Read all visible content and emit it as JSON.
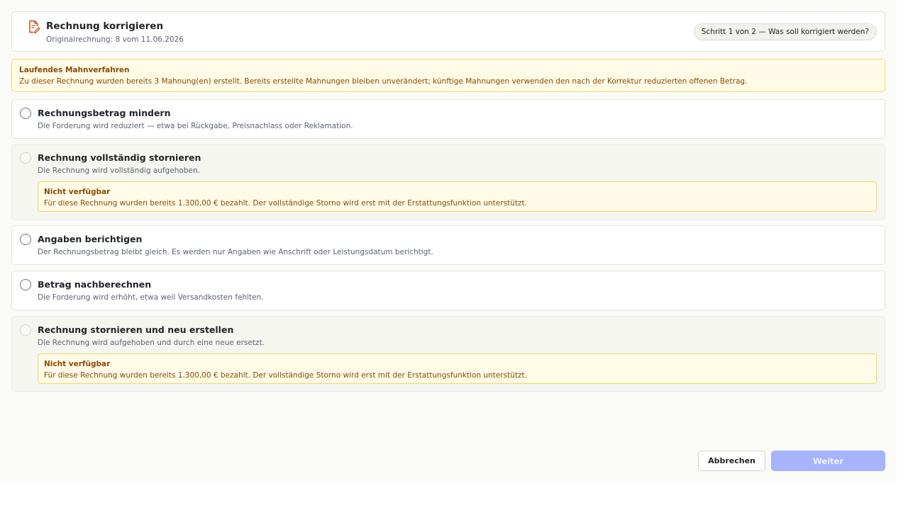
{
  "header": {
    "title": "Rechnung korrigieren",
    "subtitle": "Originalrechnung: 8 vom 11.06.2026",
    "step": "Schritt 1 von 2 — Was soll korrigiert werden?",
    "icon": "document-edit-icon",
    "accent_color": "#c2410c"
  },
  "warning": {
    "title": "Laufendes Mahnverfahren",
    "text": "Zu dieser Rechnung wurden bereits 3 Mahnung(en) erstellt. Bereits erstellte Mahnungen bleiben unverändert; künftige Mahnungen verwenden den nach der Korrektur reduzierten offenen Betrag."
  },
  "options": [
    {
      "title": "Rechnungsbetrag mindern",
      "desc": "Die Forderung wird reduziert — etwa bei Rückgabe, Preisnachlass oder Reklamation.",
      "enabled": true
    },
    {
      "title": "Rechnung vollständig stornieren",
      "desc": "Die Rechnung wird vollständig aufgehoben.",
      "enabled": false,
      "notice_title": "Nicht verfügbar",
      "notice_text": "Für diese Rechnung wurden bereits 1.300,00 € bezahlt. Der vollständige Storno wird erst mit der Erstattungsfunktion unterstützt."
    },
    {
      "title": "Angaben berichtigen",
      "desc": "Der Rechnungsbetrag bleibt gleich. Es werden nur Angaben wie Anschrift oder Leistungsdatum berichtigt.",
      "enabled": true
    },
    {
      "title": "Betrag nachberechnen",
      "desc": "Die Forderung wird erhöht, etwa weil Versandkosten fehlten.",
      "enabled": true
    },
    {
      "title": "Rechnung stornieren und neu erstellen",
      "desc": "Die Rechnung wird aufgehoben und durch eine neue ersetzt.",
      "enabled": false,
      "notice_title": "Nicht verfügbar",
      "notice_text": "Für diese Rechnung wurden bereits 1.300,00 € bezahlt. Der vollständige Storno wird erst mit der Erstattungsfunktion unterstützt."
    }
  ],
  "footer": {
    "cancel_label": "Abbrechen",
    "next_label": "Weiter",
    "next_enabled": false
  },
  "colors": {
    "warning_bg": "#fffbe6",
    "warning_border": "#f5d76a",
    "warning_text": "#8a4b08",
    "primary_disabled": "#a5b4fc"
  }
}
